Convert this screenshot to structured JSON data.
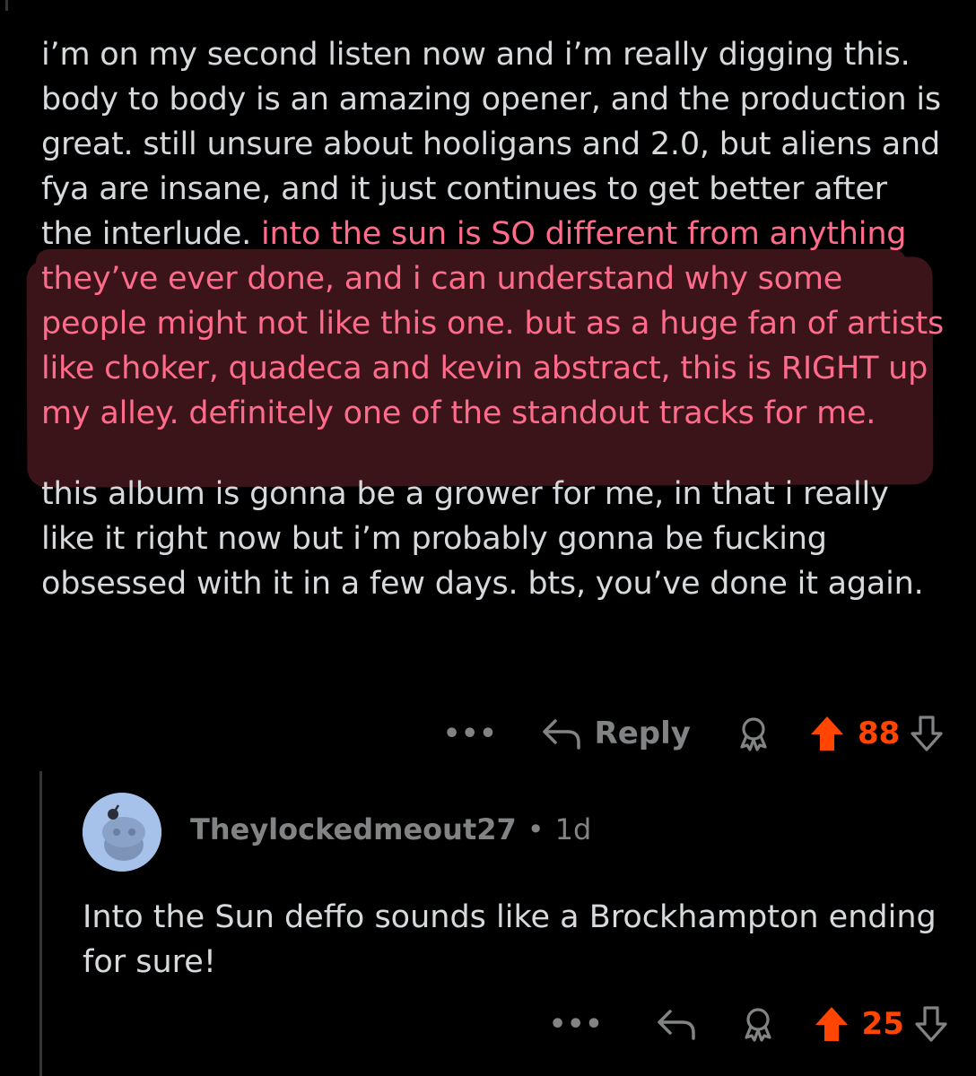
{
  "comment": {
    "text_plain": "i’m on my second listen now and i’m really digging this. body to body is an amazing opener, and the production is great. still unsure about hooligans and 2.0, but aliens and fya are insane, and it just continues to get better after the interlude. ",
    "text_highlighted": "into the sun is SO different from anything they’ve ever done, and i can understand why some people might not like this one. but as a huge fan of artists like choker, quadeca and kevin abstract, this is RIGHT up my alley. definitely one of the standout tracks for me.",
    "paragraph2": "this album is gonna be a grower for me, in that i really like it right now but i’m probably gonna be fucking obsessed with it in a few days. bts, you’ve done it again.",
    "more_label": "•••",
    "reply_label": "Reply",
    "upvotes": "88",
    "icons": {
      "more": "more-icon",
      "reply": "reply-arrow-icon",
      "award": "award-icon",
      "upvote": "upvote-arrow-icon",
      "downvote": "downvote-arrow-icon"
    }
  },
  "reply": {
    "username": "Theylockedmeout27",
    "separator": "•",
    "age": "1d",
    "text": "Into the Sun deffo sounds like a Brockhampton ending for sure!",
    "more_label": "•••",
    "upvotes": "25"
  },
  "colors": {
    "background": "#000000",
    "text": "#d7dadc",
    "muted": "#818384",
    "highlight_text": "#ff6b8b",
    "highlight_bg": "#3a1418",
    "upvote": "#ff4500",
    "avatar": "#a6c2ea"
  }
}
